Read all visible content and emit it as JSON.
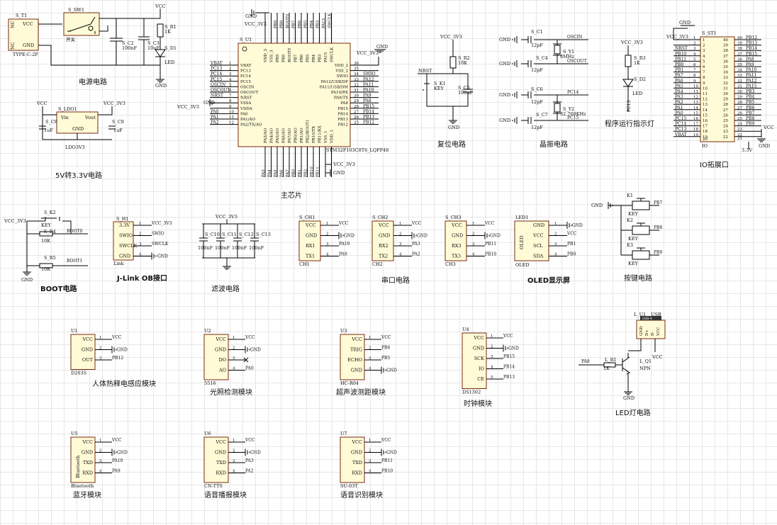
{
  "power": {
    "title": "电源电路",
    "t1": "S_T1",
    "t1_type": "TYPE-C-2P",
    "t1_vcc": "VCC",
    "t1_gnd": "GND",
    "t1_nc": "NC",
    "sw1": "S_SW1",
    "sw1_sub": "开关",
    "c2": "S_C2",
    "c2v": "100nF",
    "c3": "S_C3",
    "c3v": "10uF",
    "r1": "S_R1",
    "r1v": "1K",
    "d1": "S_D1",
    "d1v": "LED",
    "vcc": "VCC",
    "gnd": "GND"
  },
  "ldo": {
    "title": "5V转3.3V电路",
    "u": "S_LDO1",
    "part": "LDO3V3",
    "vin": "Vin",
    "vout": "Vout",
    "gnd": "GND",
    "c8": "S_C8",
    "c8v": "1uF",
    "c9": "S_C9",
    "c9v": "1uF",
    "vcc": "VCC",
    "vcc3": "VCC_3V3"
  },
  "mcu": {
    "title": "主芯片",
    "u": "S_U1",
    "part": "STM32F103C8T6_LQFP48",
    "left_pins": [
      "VBAT",
      "PC13",
      "PC14",
      "PC15",
      "OSCIN",
      "OSCOUT",
      "NRST",
      "VSSA",
      "VDDA",
      "PA0",
      "PA1/AO",
      "PA2/TX/AO"
    ],
    "left_nums": [
      "1",
      "2",
      "3",
      "4",
      "5",
      "6",
      "7",
      "8",
      "9",
      "10",
      "11",
      "12"
    ],
    "left_nets": [
      "VBAT",
      "PC13",
      "PC14",
      "PC15",
      "OSCIN",
      "OSCOUT",
      "NRST",
      "",
      "",
      "PA0",
      "PA1",
      "PA2"
    ],
    "right_pins": [
      "VDD_2",
      "VSS_2",
      "SWIO",
      "PA12/USB/DP",
      "PA11/USB/DM",
      "PA10/RX",
      "PA9/TX",
      "PA8",
      "PB15",
      "PB14",
      "PB13",
      "PB12"
    ],
    "right_nums": [
      "36",
      "35",
      "34",
      "33",
      "32",
      "31",
      "30",
      "29",
      "28",
      "27",
      "26",
      "25"
    ],
    "right_nets": [
      "",
      "",
      "SWIO",
      "PA12",
      "PA11",
      "PA10",
      "PA9",
      "PA8",
      "PB15",
      "PB14",
      "PB13",
      "PB12"
    ],
    "top_nets": [
      "PB9",
      "PB8",
      "BOOT0",
      "PB7",
      "PB6",
      "PB5",
      "PB4",
      "PB3",
      "PA15",
      "SWCLK"
    ],
    "bottom_nets": [
      "PA3",
      "PA4",
      "PA5",
      "PA6",
      "PA7",
      "PB0",
      "PB1",
      "PB2",
      "PB10",
      "PB11"
    ],
    "vcc3": "VCC_3V3",
    "gnd": "GND"
  },
  "reset": {
    "title": "复位电路",
    "r2": "S_R2",
    "r2v": "10K",
    "k1": "S_K1",
    "k1v": "KEY",
    "c5": "S_C5",
    "c5v": "100nF",
    "nrst": "NRST",
    "vcc3": "VCC_3V3",
    "gnd": "GND"
  },
  "crystal": {
    "title": "晶振电路",
    "c1": "S_C1",
    "c1v": "12pF",
    "c4": "S_C4",
    "c4v": "12pF",
    "c6": "S_C6",
    "c6v": "12pF",
    "c7": "S_C7",
    "c7v": "12pF",
    "y1": "S_Y1",
    "y1v": "8MHz",
    "y2": "S_Y2",
    "y2v": "32.768KHz",
    "oscin": "OSCIN",
    "oscout": "OSCOUT",
    "pc14": "PC14",
    "pc15": "PC15",
    "gnd": "GND"
  },
  "runled": {
    "title": "程序运行指示灯",
    "r3": "S_R3",
    "r3v": "1K",
    "d2": "S_D2",
    "d2v": "LED",
    "net": "PC13",
    "vcc3": "VCC_3V3"
  },
  "io": {
    "title": "IO拓展口",
    "u": "S_ST1",
    "part": "IO",
    "gnd": "GND",
    "vcc3": "VCC_3V3",
    "v33": "3.3V",
    "vcc": "VCC",
    "left_nets": [
      "",
      "",
      "NRST",
      "PB10",
      "PB11",
      "PB0",
      "PB1",
      "PA7",
      "PA6",
      "PA5",
      "PA4",
      "PA3",
      "PA2",
      "PA1",
      "PA0",
      "PC15",
      "PC14",
      "PC13",
      "VBAT"
    ],
    "right_nets": [
      "PB12",
      "PB13",
      "PB14",
      "PB15",
      "PA8",
      "PA9",
      "PA10",
      "PA11",
      "PA12",
      "PA15",
      "PB3",
      "PB4",
      "PB5",
      "PB6",
      "PB7",
      "PB8",
      "PB9",
      "",
      ""
    ]
  },
  "boot": {
    "title": "BOOT电路",
    "k2": "S_K2",
    "k2v": "KEY",
    "r4": "S_R4",
    "r4v": "10K",
    "r5": "S_R5",
    "r5v": "10K",
    "boot0": "BOOT0",
    "boot1": "BOOT1",
    "vcc3": "VCC_3V3",
    "gnd": "GND"
  },
  "jlink": {
    "title": "J-Link OB接口",
    "u": "S_H1",
    "part": "Link",
    "pins": [
      "3.3V",
      "SWIO",
      "SWCLK",
      "GND"
    ],
    "nets": [
      "VCC_3V3",
      "SWIO",
      "SWCLK",
      "GND"
    ]
  },
  "filter": {
    "title": "滤波电路",
    "caps": [
      "S_C10",
      "S_C11",
      "S_C12",
      "S_C13"
    ],
    "val": "100nF",
    "vcc3": "VCC_3V3"
  },
  "serial": {
    "title": "串口电路",
    "units": [
      {
        "ref": "S_CH1",
        "part": "CH1",
        "pins": [
          "VCC",
          "GND",
          "RX1",
          "TX1"
        ],
        "nets": [
          "VCC",
          "GND",
          "PA10",
          "PA9"
        ]
      },
      {
        "ref": "S_CH2",
        "part": "CH2",
        "pins": [
          "VCC",
          "GND",
          "RX2",
          "TX2"
        ],
        "nets": [
          "VCC",
          "GND",
          "PA3",
          "PA2"
        ]
      },
      {
        "ref": "S_CH3",
        "part": "CH3",
        "pins": [
          "VCC",
          "GND",
          "RX3",
          "TX3"
        ],
        "nets": [
          "VCC",
          "GND",
          "PB11",
          "PB10"
        ]
      }
    ]
  },
  "oled": {
    "title": "OLED显示屏",
    "ref": "LED1",
    "part": "OLED",
    "body": "OLED",
    "pins": [
      "GND",
      "VCC",
      "SCL",
      "SDA"
    ],
    "nets": [
      "GND",
      "VCC",
      "PB1",
      "PB0"
    ]
  },
  "keys": {
    "title": "按键电路",
    "refs": [
      "K1",
      "K2",
      "K3"
    ],
    "val": "KEY",
    "nets": [
      "PB7",
      "PB8",
      "PB9"
    ],
    "gnd": "GND"
  },
  "modules": [
    {
      "title": "人体热释电感应模块",
      "ref": "U1",
      "part": "D203S",
      "pins": [
        "VCC",
        "GND",
        "OUT"
      ],
      "nets": [
        "VCC",
        "GND",
        "PB12"
      ]
    },
    {
      "title": "光照检测模块",
      "ref": "U2",
      "part": "5516",
      "pins": [
        "VCC",
        "GND",
        "DO",
        "AO"
      ],
      "nets": [
        "VCC",
        "GND",
        "",
        "PA0"
      ]
    },
    {
      "title": "超声波测距模块",
      "ref": "U3",
      "part": "HC-R04",
      "pins": [
        "VCC",
        "TRIG",
        "ECHO",
        "GND"
      ],
      "nets": [
        "VCC",
        "PB6",
        "PB5",
        "GND"
      ]
    },
    {
      "title": "时钟模块",
      "ref": "U4",
      "part": "DS1302",
      "pins": [
        "VCC",
        "GND",
        "SCK",
        "IO",
        "CE"
      ],
      "nets": [
        "VCC",
        "GND",
        "PB15",
        "PB14",
        "PB13"
      ]
    },
    {
      "title": "蓝牙模块",
      "ref": "U5",
      "part": "Bluetooth",
      "body": "Bluetooth",
      "pins": [
        "VCC",
        "GND",
        "TXD",
        "RXD"
      ],
      "nets": [
        "VCC",
        "GND",
        "PA10",
        "PA9"
      ]
    },
    {
      "title": "语音播报模块",
      "ref": "U6",
      "part": "CN-TTS",
      "pins": [
        "VCC",
        "GND",
        "TXD",
        "RXD"
      ],
      "nets": [
        "VCC",
        "GND",
        "PA3",
        "PA2"
      ]
    },
    {
      "title": "语音识别模块",
      "ref": "U7",
      "part": "SU-03T",
      "pins": [
        "VCC",
        "GND",
        "TXD",
        "RXD"
      ],
      "nets": [
        "VCC",
        "GND",
        "PB11",
        "PB10"
      ]
    }
  ],
  "ledlight": {
    "title": "LED灯电路",
    "r1": "L_R1",
    "r1v": "1K",
    "q1": "L_Q1",
    "q1v": "NPN",
    "u1": "L_U1",
    "u1v": "USB",
    "usb_label": "USB-A",
    "usb_pins": [
      "GND",
      "D+",
      "D-",
      "VCC"
    ],
    "net": "PA8",
    "gnd": "GND",
    "vcc": "VCC"
  }
}
